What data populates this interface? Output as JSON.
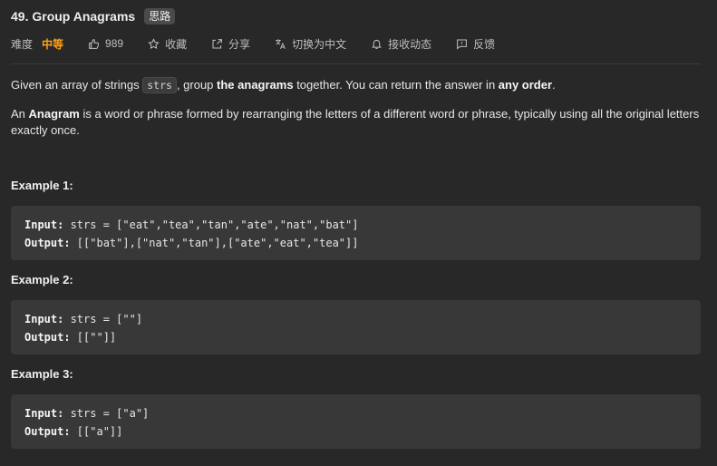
{
  "header": {
    "title": "49. Group Anagrams",
    "badge": "思路"
  },
  "meta": {
    "difficulty_label": "难度",
    "difficulty_value": "中等",
    "likes": "989",
    "favorite": "收藏",
    "share": "分享",
    "switch_lang": "切换为中文",
    "notify": "接收动态",
    "feedback": "反馈",
    "colors": {
      "difficulty": "#ffa116"
    },
    "icons": [
      "thumbs-up-icon",
      "star-icon",
      "share-icon",
      "translate-icon",
      "bell-icon",
      "feedback-icon"
    ]
  },
  "description": {
    "p1_a": "Given an array of strings ",
    "p1_code": "strs",
    "p1_b": ", group ",
    "p1_bold1": "the anagrams",
    "p1_c": " together. You can return the answer in ",
    "p1_bold2": "any order",
    "p1_d": ".",
    "p2_a": "An ",
    "p2_bold": "Anagram",
    "p2_b": " is a word or phrase formed by rearranging the letters of a different word or phrase, typically using all the original letters exactly once."
  },
  "examples": [
    {
      "title": "Example 1:",
      "input_label": "Input:",
      "input_value": " strs = [\"eat\",\"tea\",\"tan\",\"ate\",\"nat\",\"bat\"]",
      "output_label": "Output:",
      "output_value": " [[\"bat\"],[\"nat\",\"tan\"],[\"ate\",\"eat\",\"tea\"]]"
    },
    {
      "title": "Example 2:",
      "input_label": "Input:",
      "input_value": " strs = [\"\"]",
      "output_label": "Output:",
      "output_value": " [[\"\"]]"
    },
    {
      "title": "Example 3:",
      "input_label": "Input:",
      "input_value": " strs = [\"a\"]",
      "output_label": "Output:",
      "output_value": " [[\"a\"]]"
    }
  ]
}
